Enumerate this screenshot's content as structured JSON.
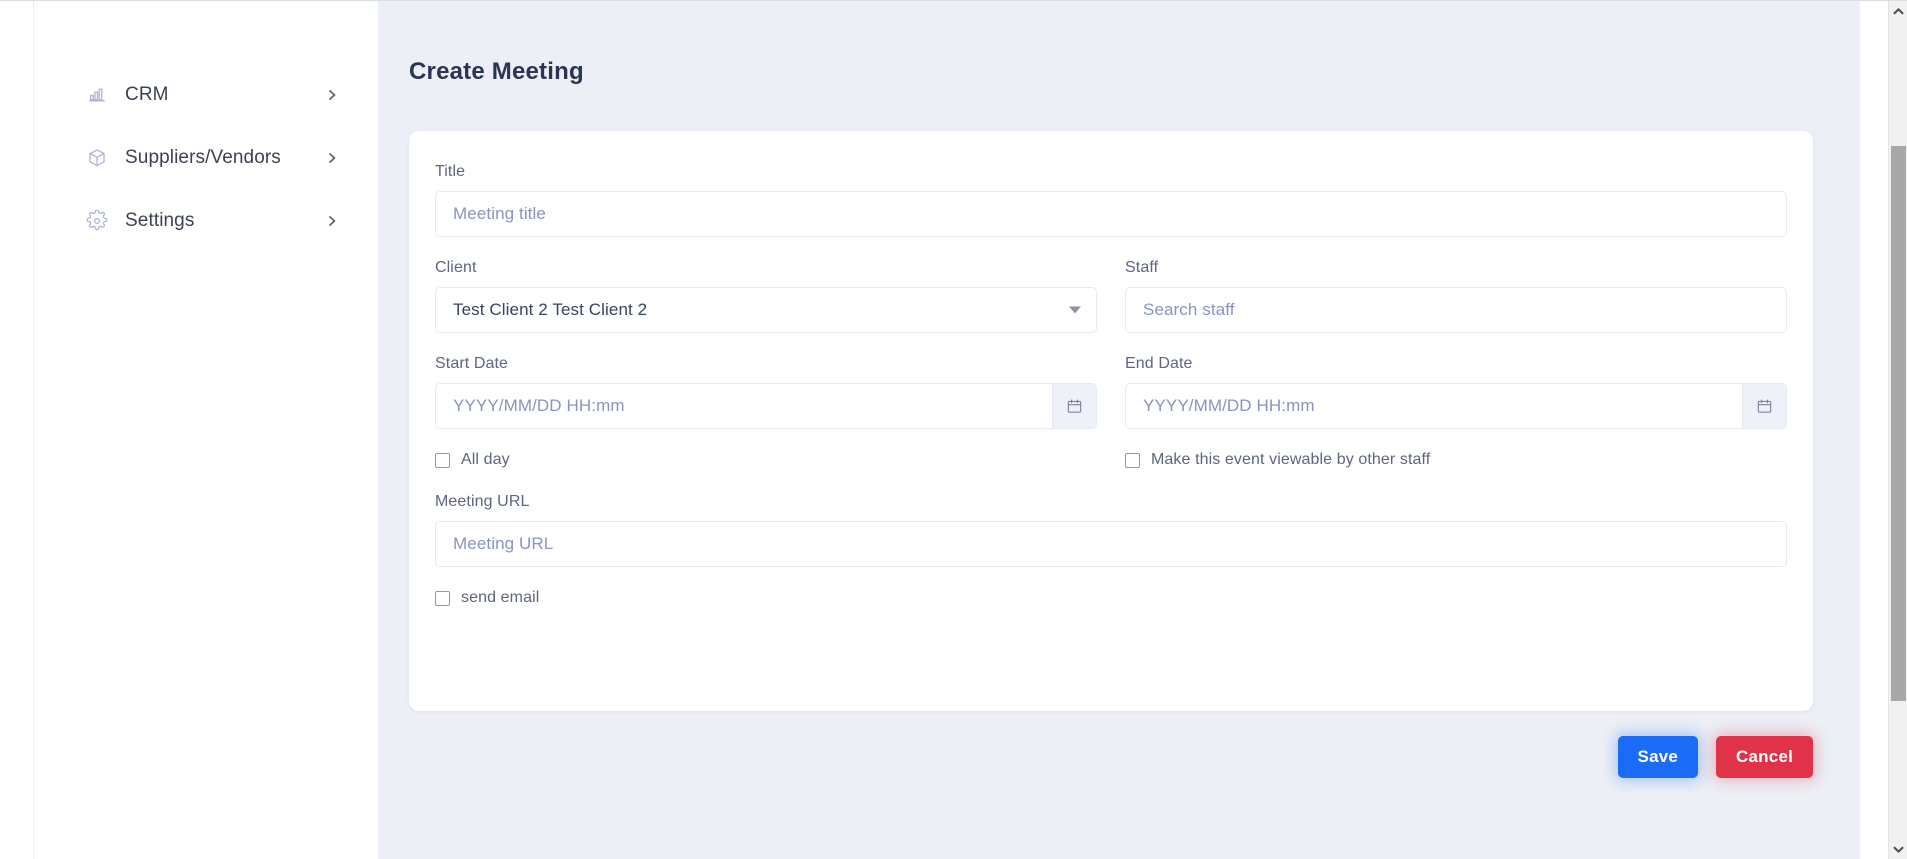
{
  "sidebar": {
    "items": [
      {
        "label": "CRM",
        "icon": "bar-chart-icon",
        "chevron": "chevron-right-icon"
      },
      {
        "label": "Suppliers/Vendors",
        "icon": "package-icon",
        "chevron": "chevron-right-icon"
      },
      {
        "label": "Settings",
        "icon": "gear-icon",
        "chevron": "chevron-right-icon"
      }
    ]
  },
  "page": {
    "title": "Create Meeting"
  },
  "form": {
    "title_field": {
      "label": "Title",
      "placeholder": "Meeting title",
      "value": ""
    },
    "client_field": {
      "label": "Client",
      "value": "Test Client 2 Test Client 2",
      "caret_icon": "chevron-down-icon"
    },
    "staff_field": {
      "label": "Staff",
      "placeholder": "Search staff",
      "value": ""
    },
    "start_date_field": {
      "label": "Start Date",
      "placeholder": "YYYY/MM/DD HH:mm",
      "value": "",
      "button_icon": "calendar-icon"
    },
    "end_date_field": {
      "label": "End Date",
      "placeholder": "YYYY/MM/DD HH:mm",
      "value": "",
      "button_icon": "calendar-icon"
    },
    "all_day_checkbox": {
      "label": "All day",
      "checked": false
    },
    "viewable_checkbox": {
      "label": "Make this event viewable by other staff",
      "checked": false
    },
    "meeting_url_field": {
      "label": "Meeting URL",
      "placeholder": "Meeting URL",
      "value": ""
    },
    "send_email_checkbox": {
      "label": "send email",
      "checked": false
    }
  },
  "actions": {
    "save_label": "Save",
    "cancel_label": "Cancel"
  },
  "colors": {
    "save_button": "#1a6bf5",
    "cancel_button": "#e0334a",
    "page_title": "#2b3553",
    "content_background": "#eceff5",
    "label_text": "#5d6583",
    "placeholder_text": "#8a93c0"
  },
  "scrollbar": {
    "up_icon": "chevron-up-icon",
    "down_icon": "chevron-down-icon"
  }
}
